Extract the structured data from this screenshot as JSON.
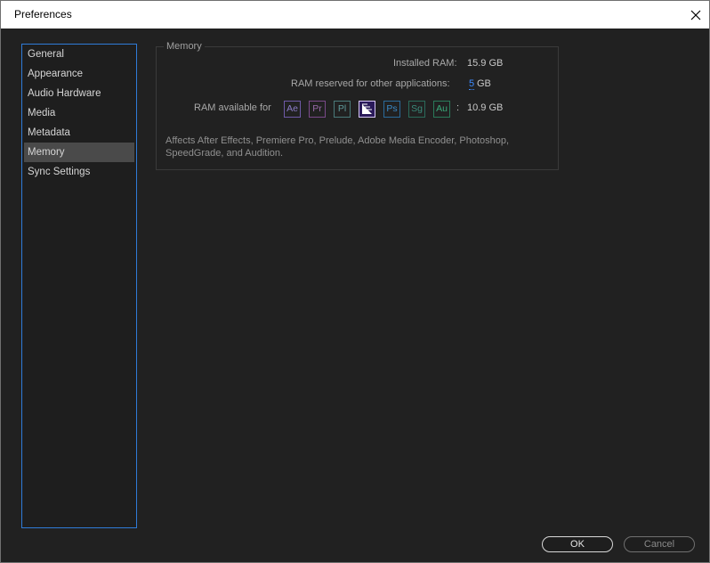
{
  "window": {
    "title": "Preferences"
  },
  "sidebar": {
    "items": [
      {
        "label": "General"
      },
      {
        "label": "Appearance"
      },
      {
        "label": "Audio Hardware"
      },
      {
        "label": "Media"
      },
      {
        "label": "Metadata"
      },
      {
        "label": "Memory",
        "selected": true
      },
      {
        "label": "Sync Settings"
      }
    ]
  },
  "memory": {
    "group_title": "Memory",
    "installed_label": "Installed RAM:",
    "installed_value": "15.9 GB",
    "reserved_label": "RAM reserved for other applications:",
    "reserved_value": "5",
    "reserved_unit": "GB",
    "available_label": "RAM available for",
    "available_colon": ":",
    "available_value": "10.9 GB",
    "apps": [
      {
        "abbr": "Ae",
        "border": "#6f5aa8",
        "text": "#8b7cc8"
      },
      {
        "abbr": "Pr",
        "border": "#7a4a8a",
        "text": "#9a6aaa"
      },
      {
        "abbr": "Pl",
        "border": "#4a7a7a",
        "text": "#5f9a9a"
      },
      {
        "abbr": "Me",
        "border": "#d8c8f8",
        "text": "#ffffff",
        "bg": "#2a1a5a"
      },
      {
        "abbr": "Ps",
        "border": "#2a6a9a",
        "text": "#3a8ac8"
      },
      {
        "abbr": "Sg",
        "border": "#2a6a5a",
        "text": "#3a8a7a"
      },
      {
        "abbr": "Au",
        "border": "#2a7a5a",
        "text": "#3aaa7a"
      }
    ],
    "description": "Affects After Effects, Premiere Pro, Prelude, Adobe Media Encoder, Photoshop, SpeedGrade, and Audition."
  },
  "buttons": {
    "ok": "OK",
    "cancel": "Cancel"
  },
  "colors": {
    "accent": "#2f7bd8",
    "link": "#3d8bff",
    "background": "#212121"
  }
}
